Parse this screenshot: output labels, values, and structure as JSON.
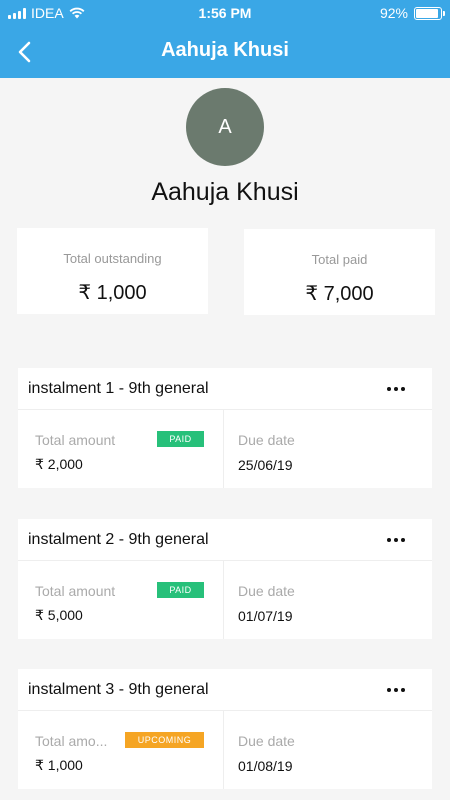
{
  "status_bar": {
    "carrier": "IDEA",
    "time": "1:56 PM",
    "battery": "92%",
    "battery_level": 0.92
  },
  "header": {
    "title": "Aahuja Khusi",
    "back_icon": "chevron-left-icon"
  },
  "profile": {
    "initial": "A",
    "name": "Aahuja Khusi",
    "avatar_color": "#6b7a6e"
  },
  "summary": {
    "outstanding_label": "Total outstanding",
    "outstanding_value": "₹ 1,000",
    "paid_label": "Total paid",
    "paid_value": "₹ 7,000"
  },
  "instalments": [
    {
      "title": "instalment 1 - 9th general",
      "amount_label": "Total amount",
      "amount": "₹ 2,000",
      "status": "PAID",
      "due_label": "Due date",
      "due_date": "25/06/19"
    },
    {
      "title": "instalment 2 - 9th general",
      "amount_label": "Total amount",
      "amount": "₹ 5,000",
      "status": "PAID",
      "due_label": "Due date",
      "due_date": "01/07/19"
    },
    {
      "title": "instalment 3 - 9th general",
      "amount_label": "Total amo...",
      "amount": "₹ 1,000",
      "status": "UPCOMING",
      "due_label": "Due date",
      "due_date": "01/08/19"
    }
  ],
  "colors": {
    "header_bg": "#3aa7e6",
    "paid_badge": "#27c07a",
    "upcoming_badge": "#f5a524"
  }
}
